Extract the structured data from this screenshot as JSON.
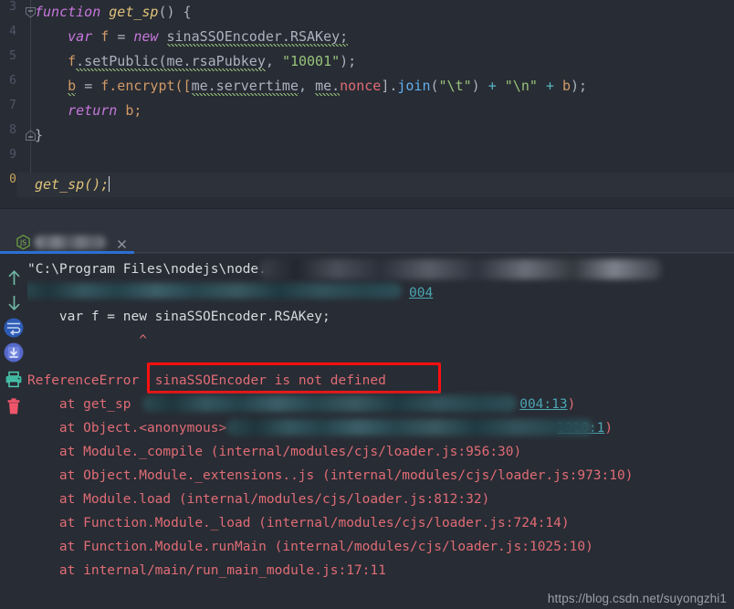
{
  "editor": {
    "language": "javascript",
    "gutter_numbers": [
      "3",
      "4",
      "5",
      "6",
      "7",
      "8",
      "9",
      "0"
    ],
    "current_line_number": "0",
    "lines": [
      {
        "indent": 0,
        "text": "function get_sp() {"
      },
      {
        "indent": 1,
        "text": "var f = new sinaSSOEncoder.RSAKey;"
      },
      {
        "indent": 1,
        "text": "f.setPublic(me.rsaPubkey, \"10001\");"
      },
      {
        "indent": 1,
        "text": "b = f.encrypt([me.servertime, me.nonce].join(\"\\t\") + \"\\n\" + b);"
      },
      {
        "indent": 1,
        "text": "return b;"
      },
      {
        "indent": 0,
        "text": "}"
      },
      {
        "indent": 0,
        "text": ""
      },
      {
        "indent": 0,
        "text": "get_sp();"
      }
    ],
    "tokens": {
      "function": "function",
      "get_sp": "get_sp",
      "paren_open_close": "() {",
      "var": "var",
      "f": "f",
      "eq": "=",
      "new": "new",
      "rsakey": "sinaSSOEncoder.RSAKey;",
      "f2": "f",
      "setpublic": ".setPublic(",
      "me_rsapubkey": "me.rsaPubkey",
      "comma": ", ",
      "str_10001": "\"10001\"",
      "close_semi": ");",
      "b": "b",
      "encrypt_open": "f.encrypt([",
      "me_servertime": "me.servertime",
      "me_dot": "me.",
      "nonce": "nonce",
      "bracket_join": "].",
      "join": "join",
      "str_tab": "\"\\t\"",
      "plus": "+",
      "str_nl": "\"\\n\"",
      "b2": "b",
      "return": "return",
      "b3": "b;",
      "brace_close": "}",
      "call_get_sp": "get_sp();"
    },
    "scrollbar": {
      "color": "#2b5fb8"
    }
  },
  "console": {
    "tab": {
      "icon": "nodejs-icon",
      "title_redacted": true,
      "close_label": "×",
      "active_underline_color": "#2b6fd4"
    },
    "toolbar": [
      {
        "name": "scroll-up-button",
        "icon": "arrow-up-icon",
        "color": "#6fb7a5"
      },
      {
        "name": "scroll-down-button",
        "icon": "arrow-down-icon",
        "color": "#6fb7a5"
      },
      {
        "name": "soft-wrap-button",
        "icon": "soft-wrap-icon",
        "color": "#3c68c4"
      },
      {
        "name": "scroll-to-end-button",
        "icon": "scroll-end-icon",
        "color": "#5f7ad6"
      },
      {
        "name": "print-button",
        "icon": "printer-icon",
        "color": "#4ec9b0"
      },
      {
        "name": "clear-all-button",
        "icon": "trash-icon",
        "color": "#f05c6c"
      }
    ],
    "output": [
      {
        "type": "command",
        "prefix": "\"C:\\Program Files\\nodejs\\node.e",
        "redacted": true,
        "suffix": "js"
      },
      {
        "type": "source-path",
        "redacted": true,
        "link": "004"
      },
      {
        "type": "blank",
        "text": ""
      },
      {
        "type": "code",
        "text": "    var f = new sinaSSOEncoder.RSAKey;"
      },
      {
        "type": "caret",
        "text": "              ^"
      },
      {
        "type": "blank",
        "text": ""
      },
      {
        "type": "error",
        "label": "ReferenceError",
        "message": "sinaSSOEncoder is not defined",
        "highlighted": true
      },
      {
        "type": "frame",
        "text": "    at get_sp ",
        "redacted": true,
        "link": "004:13",
        "tail": ")"
      },
      {
        "type": "frame",
        "text": "    at Object.<anonymous> ",
        "redacted": true,
        "link": "1010:1",
        "tail": ")"
      },
      {
        "type": "frame",
        "text": "    at Module._compile (internal/modules/cjs/loader.js:956:30)"
      },
      {
        "type": "frame",
        "text": "    at Object.Module._extensions..js (internal/modules/cjs/loader.js:973:10)"
      },
      {
        "type": "frame",
        "text": "    at Module.load (internal/modules/cjs/loader.js:812:32)"
      },
      {
        "type": "frame",
        "text": "    at Function.Module._load (internal/modules/cjs/loader.js:724:14)"
      },
      {
        "type": "frame",
        "text": "    at Function.Module.runMain (internal/modules/cjs/loader.js:1025:10)"
      },
      {
        "type": "frame",
        "text": "    at internal/main/run_main_module.js:17:11"
      }
    ],
    "annotation": {
      "color": "#ff1010",
      "shape": "rectangle"
    }
  },
  "watermark": {
    "text": "https://blog.csdn.net/suyongzhi1"
  },
  "colors": {
    "editor_bg": "#282c34",
    "panel_bg": "#2e333d",
    "error_text": "#e06c75",
    "string": "#98c379",
    "keyword": "#c678dd",
    "function": "#e0c379",
    "variable": "#d19a66",
    "plain": "#abb2bf",
    "link": "#4ba6b3",
    "annotation_red": "#ff1010"
  }
}
